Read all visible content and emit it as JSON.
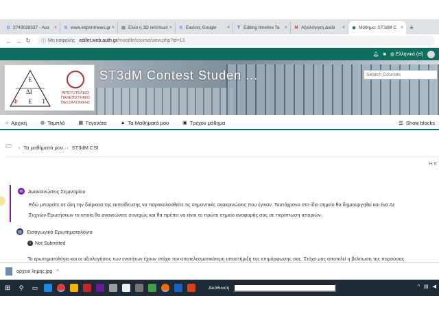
{
  "browser": {
    "tabs": [
      {
        "label": "2743028337 - Ανα",
        "favicon": "google-g-icon",
        "fav_char": "G",
        "fav_color": "#4285f4"
      },
      {
        "label": "www.edprintnews.gr",
        "favicon": "google-g-icon",
        "fav_char": "G",
        "fav_color": "#4285f4"
      },
      {
        "label": "Είναι η 3D εκτύπωση",
        "favicon": "doc-icon",
        "fav_char": "▤",
        "fav_color": "#777777"
      },
      {
        "label": "Εικόνες Google",
        "favicon": "google-g-icon",
        "fav_char": "G",
        "fav_color": "#4285f4"
      },
      {
        "label": "Editing timeline Ta",
        "favicon": "t-icon",
        "fav_char": "T",
        "fav_color": "#7a1ea1"
      },
      {
        "label": "Αξιολόγηση Διαδι",
        "favicon": "gmail-icon",
        "fav_char": "M",
        "fav_color": "#d93025"
      },
      {
        "label": "Μάθημα: ST3dM C",
        "favicon": "moodle-icon",
        "fav_char": "◉",
        "fav_color": "#0f6e5f"
      }
    ],
    "address": {
      "security": "Μη ασφαλής",
      "url_host": "edifet.web.auth.gr",
      "url_path": "/moodle/course/view.php?id=13"
    }
  },
  "moodle_nav": {
    "language": "Ελληνικά (el)"
  },
  "banner": {
    "title": "ST3dM Contest Studen ...",
    "search_placeholder": "Search Courses",
    "logo_letters": [
      "Ε",
      "ΔΙ",
      "Φ",
      "Ε",
      "Τ"
    ],
    "university_name": "ΑΡΙΣΤΟΤΕΛΕΙΟ ΠΑΝΕΠΙΣΤΗΜΙΟ ΘΕΣΣΑΛΟΝΙΚΗΣ"
  },
  "menu": {
    "items": [
      {
        "label": "Αρχική",
        "icon": "home-icon",
        "glyph": "⌂"
      },
      {
        "label": "Ταμπλό",
        "icon": "dashboard-icon",
        "glyph": "◍"
      },
      {
        "label": "Γεγονότα",
        "icon": "calendar-icon",
        "glyph": "▦"
      },
      {
        "label": "Τα Μαθήματά μου",
        "icon": "graduation-cap-icon",
        "glyph": "▲"
      },
      {
        "label": "Τρέχον μάθημα",
        "icon": "sitemap-icon",
        "glyph": "▣"
      }
    ],
    "show_blocks": "Show blocks"
  },
  "breadcrumb": {
    "items": [
      "Τα μαθήματά μου",
      "ST3dM CSI"
    ]
  },
  "right_cut_text": "Η π",
  "activities": {
    "forum": {
      "title": "Ανακοινώσεις Σεμιναρίου",
      "line1": "Εδώ μπορείτε σε όλη την διάρκεια της εκπαίδευσης να παρακολουθείτε τις σημαντικές ανακοινώσεις που έγιναν. Ταυτόχρονα στο ίδιο σημείο θα δημιουργηθεί και ένα Δε",
      "line2": "Συχνών Ερωτήσεων το οποίο θα ανανεώνετε συνεχώς και θα πρέπει να είναι το πρώτο σημείο αναφοράς σας σε περίπτωση απoριών."
    },
    "questionnaire": {
      "title": "Εισαγωγικό Ερωτηματολόγιο",
      "status": "Not Submitted",
      "description": "Το ερωτηματολόγιο και οι αξιολογήσεις των ενοτήτων έχουν στόχο την αποτελεσματικότερη υποστήριξη της επιμόρφωσης σας. Στόχο μας αποτελεί η βελτίωση της παρούσας"
    }
  },
  "download_bar": {
    "filename": "αρχειο λημης.jpg"
  },
  "taskbar": {
    "address_label": "Διεύθυνση"
  },
  "colors": {
    "brand_green": "#0f6e5f",
    "forum_purple": "#7a1ea1",
    "questionnaire_navy": "#2c3e6b"
  }
}
